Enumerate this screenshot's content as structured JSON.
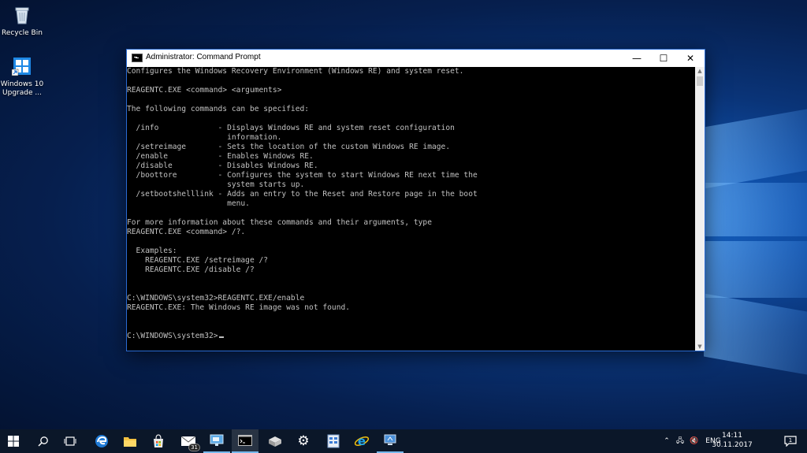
{
  "desktop": {
    "icons": [
      {
        "label": "Recycle Bin",
        "icon": "recycle-bin-icon"
      },
      {
        "label": "Windows 10 Upgrade ...",
        "icon": "windows-upgrade-icon"
      }
    ]
  },
  "window": {
    "title": "Administrator: Command Prompt",
    "buttons": {
      "minimize": "—",
      "maximize": "☐",
      "close": "✕"
    },
    "console_lines": [
      "Configures the Windows Recovery Environment (Windows RE) and system reset.",
      "",
      "REAGENTC.EXE <command> <arguments>",
      "",
      "The following commands can be specified:",
      "",
      "  /info             - Displays Windows RE and system reset configuration",
      "                      information.",
      "  /setreimage       - Sets the location of the custom Windows RE image.",
      "  /enable           - Enables Windows RE.",
      "  /disable          - Disables Windows RE.",
      "  /boottore         - Configures the system to start Windows RE next time the",
      "                      system starts up.",
      "  /setbootshelllink - Adds an entry to the Reset and Restore page in the boot",
      "                      menu.",
      "",
      "For more information about these commands and their arguments, type",
      "REAGENTC.EXE <command> /?.",
      "",
      "  Examples:",
      "    REAGENTC.EXE /setreimage /?",
      "    REAGENTC.EXE /disable /?",
      "",
      "",
      "C:\\WINDOWS\\system32>REAGENTC.EXE/enable",
      "REAGENTC.EXE: The Windows RE image was not found.",
      "",
      ""
    ],
    "prompt": "C:\\WINDOWS\\system32>"
  },
  "taskbar": {
    "items": [
      {
        "name": "start-button",
        "icon": "windows-logo-icon"
      },
      {
        "name": "search-button",
        "icon": "search-icon"
      },
      {
        "name": "task-view-button",
        "icon": "task-view-icon"
      },
      {
        "name": "edge-button",
        "icon": "edge-icon"
      },
      {
        "name": "file-explorer-button",
        "icon": "folder-icon"
      },
      {
        "name": "store-button",
        "icon": "store-icon"
      },
      {
        "name": "mail-button",
        "icon": "mail-icon",
        "badge": "31"
      },
      {
        "name": "remote-desktop-button",
        "icon": "remote-desktop-icon"
      },
      {
        "name": "command-prompt-button",
        "icon": "cmd-icon"
      },
      {
        "name": "drive-button",
        "icon": "drive-icon"
      },
      {
        "name": "settings-button",
        "icon": "gear-icon"
      },
      {
        "name": "registry-button",
        "icon": "registry-icon"
      },
      {
        "name": "ie-button",
        "icon": "internet-explorer-icon"
      },
      {
        "name": "network-app-button",
        "icon": "computer-icon"
      }
    ],
    "tray": {
      "language": "ENG",
      "time": "14:11",
      "date": "30.11.2017"
    }
  },
  "colors": {
    "accent": "#76b9ed",
    "console_bg": "#000000",
    "console_text": "#c0c0c0",
    "taskbar_bg": "#0b1729"
  }
}
